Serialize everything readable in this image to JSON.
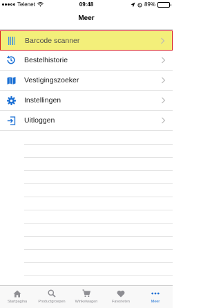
{
  "status_bar": {
    "carrier": "Telenet",
    "time": "09:48",
    "battery": "89%",
    "battery_level": 0.89
  },
  "nav": {
    "title": "Meer"
  },
  "menu": {
    "items": [
      {
        "label": "Barcode scanner",
        "icon": "barcode-icon",
        "highlighted": true
      },
      {
        "label": "Bestelhistorie",
        "icon": "history-icon"
      },
      {
        "label": "Vestigingszoeker",
        "icon": "map-icon"
      },
      {
        "label": "Instellingen",
        "icon": "gear-icon"
      },
      {
        "label": "Uitloggen",
        "icon": "logout-icon"
      }
    ]
  },
  "tabbar": {
    "tabs": [
      {
        "label": "Startpagina",
        "icon": "home-icon"
      },
      {
        "label": "Productgroepen",
        "icon": "search-icon"
      },
      {
        "label": "Winkelwagen",
        "icon": "cart-icon"
      },
      {
        "label": "Favorieten",
        "icon": "heart-icon"
      },
      {
        "label": "Meer",
        "icon": "more-icon",
        "active": true
      }
    ]
  },
  "colors": {
    "accent": "#1a6fd4",
    "highlight_fill": "#f3ef7a",
    "highlight_border": "#d81b1b",
    "inactive": "#8e8e93"
  }
}
